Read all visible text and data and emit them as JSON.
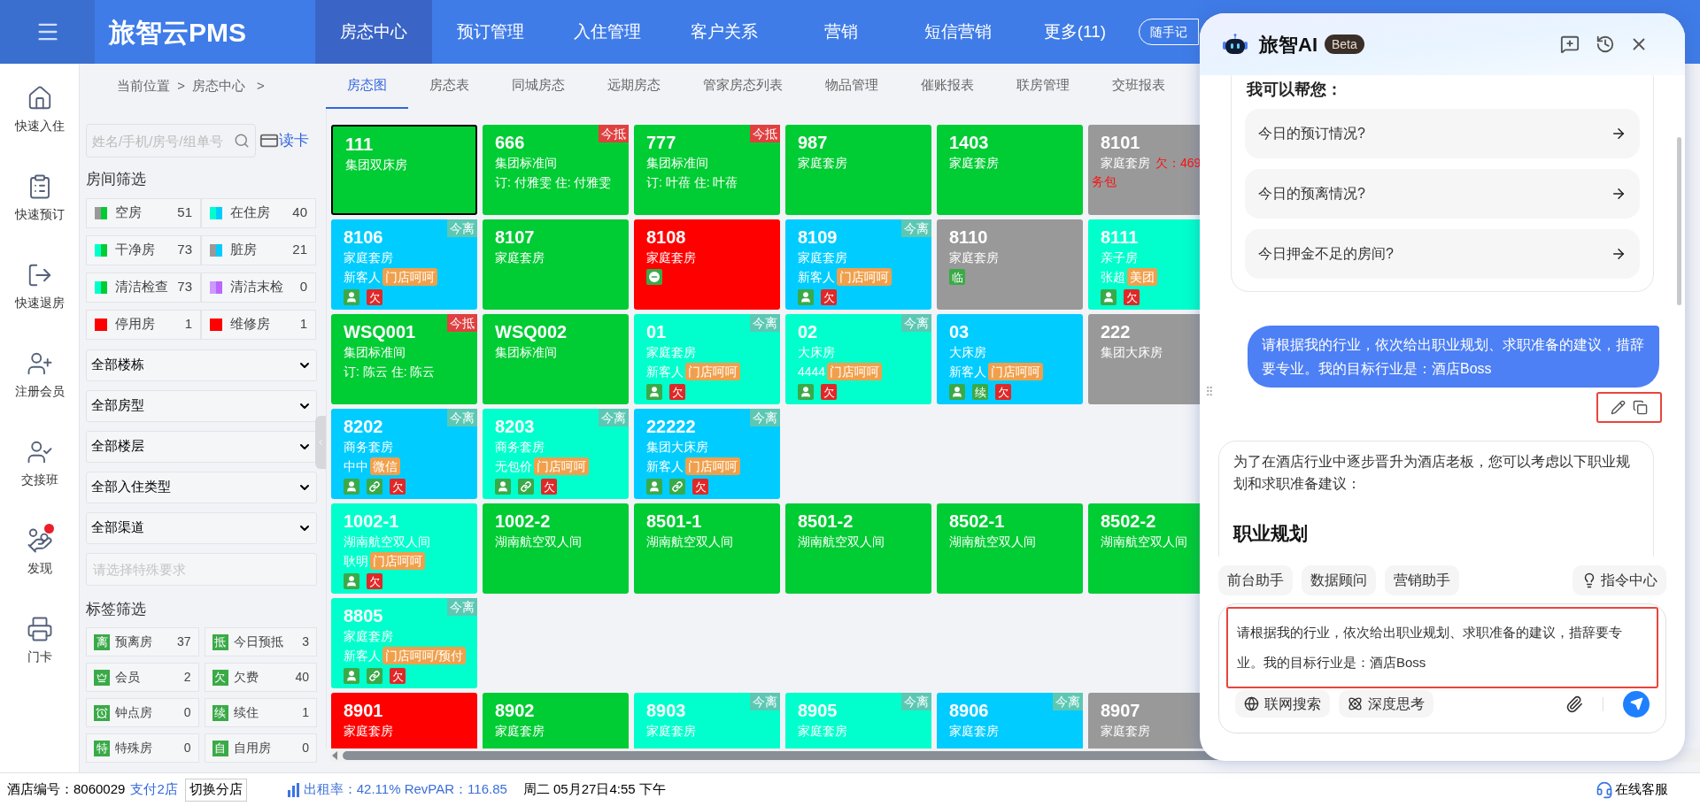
{
  "top_bar": {
    "logo": "旅智云PMS",
    "nav": [
      {
        "label": "房态中心",
        "selected": true
      },
      {
        "label": "预订管理",
        "selected": false
      },
      {
        "label": "入住管理",
        "selected": false
      },
      {
        "label": "客户关系",
        "selected": false
      },
      {
        "label": "营销",
        "selected": false
      },
      {
        "label": "短信营销",
        "selected": false
      },
      {
        "label": "更多(11)",
        "selected": false
      }
    ],
    "memo_button": "随手记",
    "menu_expanded": true
  },
  "side_rail": [
    {
      "kind": "checkin",
      "label": "快速入住",
      "notify": false
    },
    {
      "kind": "booking",
      "label": "快速预订",
      "notify": false
    },
    {
      "kind": "checkout",
      "label": "快速退房",
      "notify": false
    },
    {
      "kind": "member",
      "label": "注册会员",
      "notify": false
    },
    {
      "kind": "shift",
      "label": "交接班",
      "notify": false
    },
    {
      "kind": "discover",
      "label": "发现",
      "notify": true
    },
    {
      "kind": "card",
      "label": "门卡",
      "notify": false
    }
  ],
  "breadcrumb": "当前位置  >  房态中心   >",
  "filters": {
    "search_placeholder": "姓名/手机/房号/组单号",
    "read_card": "读卡",
    "room_heading": "房间筛选",
    "status": [
      {
        "label": "空房",
        "count": "51",
        "swatch": [
          {
            "color": "#999999"
          },
          {
            "color": "#00cc33"
          }
        ]
      },
      {
        "label": "在住房",
        "count": "40",
        "swatch": [
          {
            "color": "#00ffcc"
          },
          {
            "color": "#00ccff"
          }
        ]
      },
      {
        "label": "干净房",
        "count": "73",
        "swatch": [
          {
            "color": "#00ffcc"
          },
          {
            "color": "#00cc33"
          }
        ]
      },
      {
        "label": "脏房",
        "count": "21",
        "swatch": [
          {
            "color": "#999999"
          },
          {
            "color": "#00ccff"
          }
        ]
      },
      {
        "label": "清洁检查",
        "count": "73",
        "swatch": [
          {
            "color": "#00ffcc"
          },
          {
            "color": "#00cc33"
          }
        ]
      },
      {
        "label": "清洁末检",
        "count": "0",
        "swatch": [
          {
            "color": "#cc99ff"
          },
          {
            "color": "#bb66ff"
          }
        ]
      },
      {
        "label": "停用房",
        "count": "1",
        "swatch": [
          {
            "color": "#ff0000"
          }
        ]
      },
      {
        "label": "维修房",
        "count": "1",
        "swatch": [
          {
            "color": "#ff0000"
          }
        ]
      }
    ],
    "dropdowns": [
      "全部楼栋",
      "全部房型",
      "全部楼层",
      "全部入住类型",
      "全部渠道"
    ],
    "special_placeholder": "请选择特殊要求",
    "tag_heading": "标签筛选",
    "tags": [
      {
        "kind": "letter",
        "glyph": "离",
        "label": "预离房",
        "count": "37"
      },
      {
        "kind": "letter",
        "glyph": "抵",
        "label": "今日预抵",
        "count": "3"
      },
      {
        "kind": "vip",
        "label": "会员",
        "count": "2"
      },
      {
        "kind": "letter",
        "glyph": "欠",
        "label": "欠费",
        "count": "40"
      },
      {
        "kind": "clock",
        "label": "钟点房",
        "count": "0"
      },
      {
        "kind": "letter",
        "glyph": "续",
        "label": "续住",
        "count": "1"
      },
      {
        "kind": "letter",
        "glyph": "特",
        "label": "特殊房",
        "count": "0"
      },
      {
        "kind": "letter",
        "glyph": "自",
        "label": "自用房",
        "count": "0"
      }
    ]
  },
  "sub_tabs": [
    {
      "label": "房态图",
      "selected": true
    },
    {
      "label": "房态表",
      "selected": false
    },
    {
      "label": "同城房态",
      "selected": false
    },
    {
      "label": "远期房态",
      "selected": false
    },
    {
      "label": "管家房态列表",
      "selected": false
    },
    {
      "label": "物品管理",
      "selected": false
    },
    {
      "label": "催账报表",
      "selected": false
    },
    {
      "label": "联房管理",
      "selected": false
    },
    {
      "label": "交班报表",
      "selected": false
    }
  ],
  "floors": [
    [
      {
        "number": "111",
        "type": "集团双床房",
        "color": "#00cc33",
        "selected": true
      },
      {
        "number": "666",
        "type": "集团标准间",
        "guest": "订: 付雅雯 住: 付雅雯",
        "badge": {
          "kind": "arrive",
          "text": "今抵"
        },
        "color": "#00cc33",
        "selected": false
      },
      {
        "number": "777",
        "type": "集团标准间",
        "guest": "订: 叶蓓 住: 叶蓓",
        "badge": {
          "kind": "arrive",
          "text": "今抵"
        },
        "color": "#00cc33",
        "selected": false
      },
      {
        "number": "987",
        "type": "家庭套房",
        "color": "#00cc33",
        "selected": false
      },
      {
        "number": "1403",
        "type": "家庭套房",
        "color": "#00cc33",
        "selected": false
      },
      {
        "number": "8101",
        "type": "家庭套房",
        "debt": "欠：469",
        "note": "务包",
        "color": "#999999",
        "selected": false
      }
    ],
    [
      {
        "number": "8106",
        "type": "家庭套房",
        "guest": "新客人",
        "channel": "门店呵呵",
        "marks": [
          {
            "kind": "guest"
          },
          {
            "kind": "letter",
            "text": "欠",
            "color": "#e02828"
          }
        ],
        "badge": {
          "kind": "leave",
          "text": "今离"
        },
        "color": "#00ccff",
        "selected": false
      },
      {
        "number": "8107",
        "type": "家庭套房",
        "color": "#00cc33",
        "selected": false
      },
      {
        "number": "8108",
        "type": "家庭套房",
        "marks": [
          {
            "kind": "stop"
          }
        ],
        "color": "#ff0000",
        "selected": false
      },
      {
        "number": "8109",
        "type": "家庭套房",
        "guest": "新客人",
        "channel": "门店呵呵",
        "marks": [
          {
            "kind": "guest"
          },
          {
            "kind": "letter",
            "text": "欠",
            "color": "#e02828"
          }
        ],
        "badge": {
          "kind": "leave",
          "text": "今离"
        },
        "color": "#00ccff",
        "selected": false
      },
      {
        "number": "8110",
        "type": "家庭套房",
        "marks": [
          {
            "kind": "letter",
            "text": "临",
            "color": "#3aaa48"
          }
        ],
        "color": "#999999",
        "selected": false
      },
      {
        "number": "8111",
        "type": "亲子房",
        "guest": "张超",
        "channel": "美团",
        "marks": [
          {
            "kind": "guest"
          },
          {
            "kind": "letter",
            "text": "欠",
            "color": "#e02828"
          }
        ],
        "color": "#00ffcc",
        "selected": false
      }
    ],
    [
      {
        "number": "WSQ001",
        "type": "集团标准间",
        "guest": "订: 陈云 住: 陈云",
        "badge": {
          "kind": "arrive",
          "text": "今抵"
        },
        "color": "#00cc33",
        "selected": false
      },
      {
        "number": "WSQ002",
        "type": "集团标准间",
        "color": "#00cc33",
        "selected": false
      },
      {
        "number": "01",
        "type": "家庭套房",
        "guest": "新客人",
        "channel": "门店呵呵",
        "marks": [
          {
            "kind": "guest"
          },
          {
            "kind": "letter",
            "text": "欠",
            "color": "#e02828"
          }
        ],
        "badge": {
          "kind": "leave",
          "text": "今离"
        },
        "color": "#00ffcc",
        "selected": false
      },
      {
        "number": "02",
        "type": "大床房",
        "guest": "4444",
        "channel": "门店呵呵",
        "marks": [
          {
            "kind": "guest"
          },
          {
            "kind": "letter",
            "text": "欠",
            "color": "#e02828"
          }
        ],
        "badge": {
          "kind": "leave",
          "text": "今离"
        },
        "color": "#00ffcc",
        "selected": false
      },
      {
        "number": "03",
        "type": "大床房",
        "guest": "新客人",
        "channel": "门店呵呵",
        "marks": [
          {
            "kind": "guest"
          },
          {
            "kind": "letter",
            "text": "续",
            "color": "#3aaa48"
          },
          {
            "kind": "letter",
            "text": "欠",
            "color": "#e02828"
          }
        ],
        "color": "#00ccff",
        "selected": false
      },
      {
        "number": "222",
        "type": "集团大床房",
        "color": "#999999",
        "selected": false
      }
    ],
    [
      {
        "number": "8202",
        "type": "商务套房",
        "guest": "中中",
        "channel": "微信",
        "marks": [
          {
            "kind": "guest"
          },
          {
            "kind": "link"
          },
          {
            "kind": "letter",
            "text": "欠",
            "color": "#e02828"
          }
        ],
        "badge": {
          "kind": "leave",
          "text": "今离"
        },
        "color": "#00ccff",
        "selected": false
      },
      {
        "number": "8203",
        "type": "商务套房",
        "guest": "无包价",
        "channel": "门店呵呵",
        "marks": [
          {
            "kind": "guest"
          },
          {
            "kind": "link"
          },
          {
            "kind": "letter",
            "text": "欠",
            "color": "#e02828"
          }
        ],
        "badge": {
          "kind": "leave",
          "text": "今离"
        },
        "color": "#00ffcc",
        "selected": false
      },
      {
        "number": "22222",
        "type": "集团大床房",
        "guest": "新客人",
        "channel": "门店呵呵",
        "marks": [
          {
            "kind": "guest"
          },
          {
            "kind": "link"
          },
          {
            "kind": "letter",
            "text": "欠",
            "color": "#e02828"
          }
        ],
        "badge": {
          "kind": "leave",
          "text": "今离"
        },
        "color": "#00ccff",
        "selected": false
      }
    ],
    [
      {
        "number": "1002-1",
        "type": "湖南航空双人间",
        "guest": "耿明",
        "channel": "门店呵呵",
        "marks": [
          {
            "kind": "guest"
          },
          {
            "kind": "letter",
            "text": "欠",
            "color": "#e02828"
          }
        ],
        "color": "#00ffcc",
        "selected": false
      },
      {
        "number": "1002-2",
        "type": "湖南航空双人间",
        "color": "#00cc33",
        "selected": false
      },
      {
        "number": "8501-1",
        "type": "湖南航空双人间",
        "color": "#00cc33",
        "selected": false
      },
      {
        "number": "8501-2",
        "type": "湖南航空双人间",
        "color": "#00cc33",
        "selected": false
      },
      {
        "number": "8502-1",
        "type": "湖南航空双人间",
        "color": "#00cc33",
        "selected": false
      },
      {
        "number": "8502-2",
        "type": "湖南航空双人间",
        "color": "#00cc33",
        "selected": false
      }
    ],
    [
      {
        "number": "8805",
        "type": "家庭套房",
        "guest": "新客人",
        "channel": "门店呵呵/预付",
        "marks": [
          {
            "kind": "guest"
          },
          {
            "kind": "link"
          },
          {
            "kind": "letter",
            "text": "欠",
            "color": "#e02828"
          }
        ],
        "badge": {
          "kind": "leave",
          "text": "今离"
        },
        "color": "#00ffcc",
        "selected": false
      }
    ],
    [
      {
        "number": "8901",
        "type": "家庭套房",
        "color": "#ff0000",
        "selected": false
      },
      {
        "number": "8902",
        "type": "家庭套房",
        "color": "#00cc33",
        "selected": false
      },
      {
        "number": "8903",
        "type": "家庭套房",
        "badge": {
          "kind": "leave",
          "text": "今离"
        },
        "color": "#00ffcc",
        "selected": false
      },
      {
        "number": "8905",
        "type": "家庭套房",
        "badge": {
          "kind": "leave",
          "text": "今离"
        },
        "color": "#00ffcc",
        "selected": false
      },
      {
        "number": "8906",
        "type": "家庭套房",
        "badge": {
          "kind": "leave",
          "text": "今离"
        },
        "color": "#00ccff",
        "selected": false
      },
      {
        "number": "8907",
        "type": "家庭套房",
        "color": "#999999",
        "selected": false
      }
    ]
  ],
  "status_bar": {
    "hotel": "酒店编号：8060029",
    "branch_link": "支付2店",
    "switch_button": "切换分店",
    "occupancy": "出租率：42.11% RevPAR：116.85",
    "datetime": "周二 05月27日4:55 下午",
    "support": "在线客服"
  },
  "ai_panel": {
    "title": "旅智AI",
    "badge": "Beta",
    "intro_heading": "我可以帮您：",
    "suggestions": [
      "今日的预订情况?",
      "今日的预离情况?",
      "今日押金不足的房间?"
    ],
    "user_message": "请根据我的行业，依次给出职业规划、求职准备的建议，措辞要专业。我的目标行业是：酒店Boss",
    "answer": {
      "paragraph": "为了在酒店行业中逐步晋升为酒店老板，您可以考虑以下职业规划和求职准备建议：",
      "heading": "职业规划"
    },
    "assistants": [
      "前台助手",
      "数据顾问",
      "营销助手"
    ],
    "command_center": "指令中心",
    "input_value": "请根据我的行业，依次给出职业规划、求职准备的建议，措辞要专业。我的目标行业是：酒店Boss",
    "tools": [
      {
        "kind": "web",
        "label": "联网搜索"
      },
      {
        "kind": "think",
        "label": "深度思考"
      }
    ]
  }
}
